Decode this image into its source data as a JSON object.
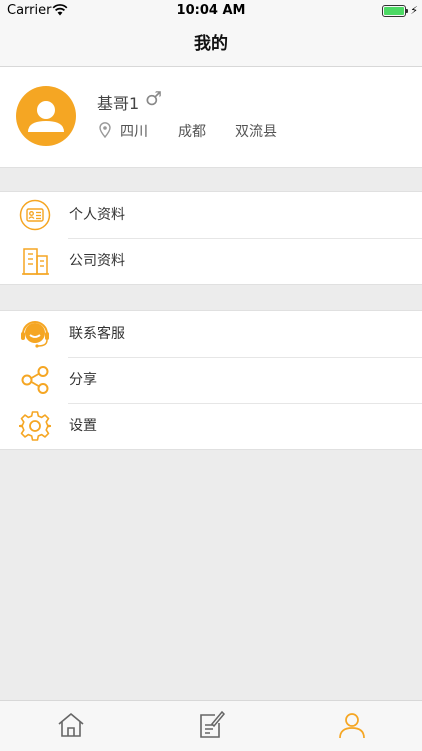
{
  "status_bar": {
    "carrier": "Carrier",
    "time": "10:04 AM",
    "battery_level": 1.0
  },
  "nav": {
    "title": "我的"
  },
  "profile": {
    "name": "基哥1",
    "gender_symbol": "♂",
    "province": "四川",
    "city": "成都",
    "county": "双流县"
  },
  "menu_group_1": [
    {
      "label": "个人资料",
      "icon": "id-card-icon"
    },
    {
      "label": "公司资料",
      "icon": "building-icon"
    }
  ],
  "menu_group_2": [
    {
      "label": "联系客服",
      "icon": "headset-icon"
    },
    {
      "label": "分享",
      "icon": "share-icon"
    },
    {
      "label": "设置",
      "icon": "gear-icon"
    }
  ],
  "tabs": [
    {
      "icon": "home-icon",
      "active": false
    },
    {
      "icon": "edit-note-icon",
      "active": false
    },
    {
      "icon": "user-icon",
      "active": true
    }
  ],
  "colors": {
    "accent": "#f5a623",
    "background": "#ececec",
    "tab_inactive": "#666666"
  }
}
